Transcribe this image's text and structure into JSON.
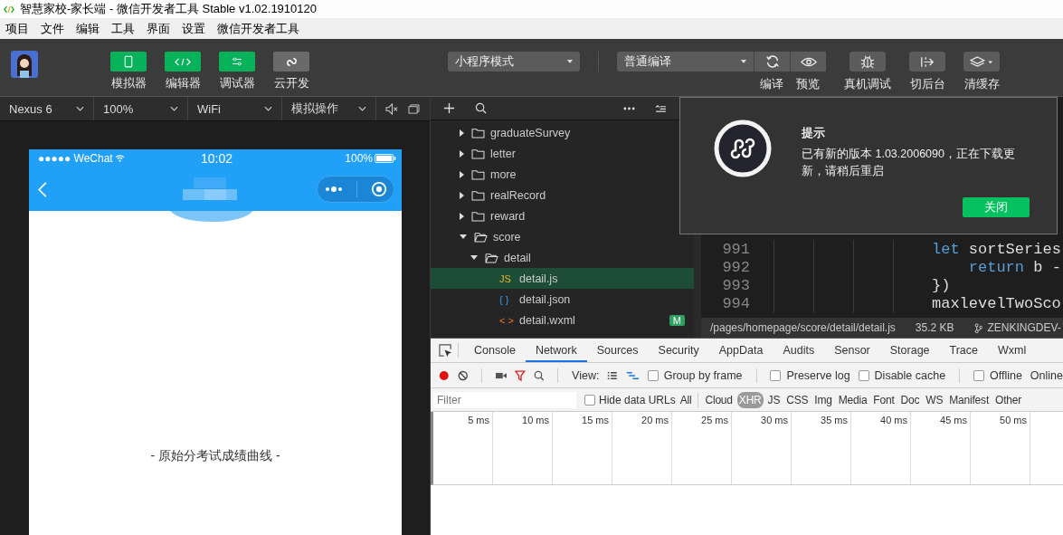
{
  "window": {
    "title": "智慧家校-家长端 - 微信开发者工具 Stable v1.02.1910120"
  },
  "menu": [
    "项目",
    "文件",
    "编辑",
    "工具",
    "界面",
    "设置",
    "微信开发者工具"
  ],
  "toolbar": {
    "views": [
      {
        "label": "模拟器",
        "on": true,
        "kind": "phone"
      },
      {
        "label": "编辑器",
        "on": true,
        "kind": "code"
      },
      {
        "label": "调试器",
        "on": true,
        "kind": "sliders"
      },
      {
        "label": "云开发",
        "on": false,
        "kind": "cloud"
      }
    ],
    "mode": "小程序模式",
    "compile": "普通编译",
    "actions": [
      {
        "label": "编译",
        "kind": "refresh",
        "joined": true
      },
      {
        "label": "预览",
        "kind": "eye",
        "joined": true
      },
      {
        "label": "真机调试",
        "kind": "bug",
        "joined": false
      },
      {
        "label": "切后台",
        "kind": "exit",
        "joined": false
      },
      {
        "label": "清缓存",
        "kind": "layers",
        "joined": false
      }
    ]
  },
  "simulator": {
    "selects": [
      "Nexus 6",
      "100%",
      "WiFi",
      "模拟操作"
    ],
    "phone": {
      "carrier": "●●●●● WeChat",
      "time": "10:02",
      "battery": "100%",
      "content": "- 原始分考试成绩曲线 -"
    }
  },
  "file_tree": [
    {
      "name": "graduateSurvey",
      "kind": "folder",
      "expanded": false
    },
    {
      "name": "letter",
      "kind": "folder",
      "expanded": false
    },
    {
      "name": "more",
      "kind": "folder",
      "expanded": false
    },
    {
      "name": "realRecord",
      "kind": "folder",
      "expanded": false
    },
    {
      "name": "reward",
      "kind": "folder",
      "expanded": false
    },
    {
      "name": "score",
      "kind": "folder",
      "expanded": true,
      "children": [
        {
          "name": "detail",
          "kind": "folder",
          "expanded": true,
          "children": [
            {
              "name": "detail.js",
              "kind": "js",
              "icon": "JS",
              "selected": true
            },
            {
              "name": "detail.json",
              "kind": "json",
              "icon": "{ }",
              "selected": false
            },
            {
              "name": "detail.wxml",
              "kind": "wxml",
              "icon": "< >",
              "selected": false,
              "badge": "M"
            }
          ]
        }
      ]
    }
  ],
  "code": [
    {
      "number": "991",
      "parts": [
        {
          "text": "let",
          "kind": "keyword"
        },
        {
          "text": " sortSeries",
          "kind": "plain"
        }
      ]
    },
    {
      "number": "992",
      "parts": [
        {
          "text": "    return",
          "kind": "keyword"
        },
        {
          "text": " b -",
          "kind": "plain"
        }
      ]
    },
    {
      "number": "993",
      "parts": [
        {
          "text": "})",
          "kind": "plain"
        }
      ]
    },
    {
      "number": "994",
      "parts": [
        {
          "text": "maxlevelTwoSco",
          "kind": "plain"
        }
      ]
    }
  ],
  "status_bar": {
    "path": "/pages/homepage/score/detail/detail.js",
    "size": "35.2 KB",
    "branch": "ZENKINGDEV-"
  },
  "dialog": {
    "title": "提示",
    "message": "已有新的版本 1.03.2006090，正在下载更新，请稍后重启",
    "button": "关闭"
  },
  "devtools": {
    "tabs": [
      {
        "label": "Console",
        "selected": false
      },
      {
        "label": "Network",
        "selected": true
      },
      {
        "label": "Sources",
        "selected": false
      },
      {
        "label": "Security",
        "selected": false
      },
      {
        "label": "AppData",
        "selected": false
      },
      {
        "label": "Audits",
        "selected": false
      },
      {
        "label": "Sensor",
        "selected": false
      },
      {
        "label": "Storage",
        "selected": false
      },
      {
        "label": "Trace",
        "selected": false
      },
      {
        "label": "Wxml",
        "selected": false
      }
    ],
    "recording": true,
    "filter_on": true,
    "view_label": "View:",
    "waterfall_selected": true,
    "options": [
      {
        "label": "Group by frame",
        "checked": false
      },
      {
        "label": "Preserve log",
        "checked": false
      },
      {
        "label": "Disable cache",
        "checked": false
      },
      {
        "label": "Offline",
        "checked": false
      }
    ],
    "throttle": "Online",
    "filter": {
      "placeholder": "Filter",
      "hide_data_urls": {
        "label": "Hide data URLs",
        "checked": false
      },
      "types": [
        {
          "label": "All",
          "selected": false
        },
        {
          "label": "Cloud",
          "selected": false
        },
        {
          "label": "XHR",
          "selected": true
        },
        {
          "label": "JS",
          "selected": false
        },
        {
          "label": "CSS",
          "selected": false
        },
        {
          "label": "Img",
          "selected": false
        },
        {
          "label": "Media",
          "selected": false
        },
        {
          "label": "Font",
          "selected": false
        },
        {
          "label": "Doc",
          "selected": false
        },
        {
          "label": "WS",
          "selected": false
        },
        {
          "label": "Manifest",
          "selected": false
        },
        {
          "label": "Other",
          "selected": false
        }
      ]
    },
    "ticks": [
      "5 ms",
      "10 ms",
      "15 ms",
      "20 ms",
      "25 ms",
      "30 ms",
      "35 ms",
      "40 ms",
      "45 ms",
      "50 ms"
    ]
  }
}
